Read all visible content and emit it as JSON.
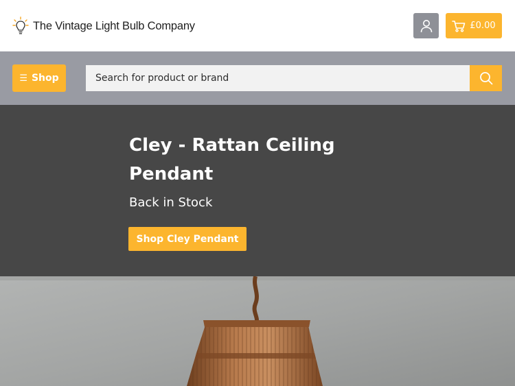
{
  "header": {
    "logo_text": "The Vintage Light Bulb Company",
    "cart_total": "£0.00"
  },
  "search": {
    "shop_label": "Shop",
    "placeholder": "Search for product or brand"
  },
  "hero": {
    "title": "Cley - Rattan Ceiling Pendant",
    "subtitle": "Back in Stock",
    "cta_label": "Shop Cley Pendant"
  },
  "colors": {
    "accent": "#fcb52e",
    "account_button": "#8e9097",
    "search_bar": "#999ba3",
    "hero_background": "#474747"
  },
  "icons": {
    "logo": "lightbulb-icon",
    "account": "user-icon",
    "cart": "cart-icon",
    "menu": "hamburger-icon",
    "search": "search-icon"
  }
}
